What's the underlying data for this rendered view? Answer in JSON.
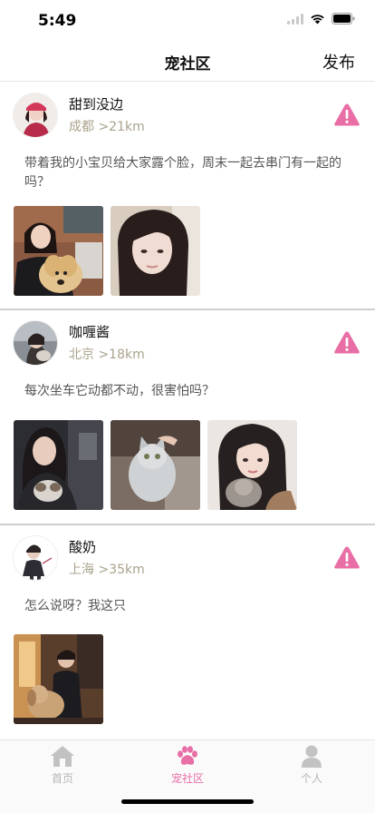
{
  "status_bar": {
    "time": "5:49"
  },
  "nav": {
    "title": "宠社区",
    "publish_label": "发布"
  },
  "posts": [
    {
      "username": "甜到没边",
      "location": "成都 >21km",
      "text": "带着我的小宝贝给大家露个脸，周末一起去串门有一起的吗？",
      "photo_count": 2
    },
    {
      "username": "咖喱酱",
      "location": "北京 >18km",
      "text": "每次坐车它动都不动，很害怕吗？",
      "photo_count": 3
    },
    {
      "username": "酸奶",
      "location": "上海 >35km",
      "text": "怎么说呀？我这只",
      "photo_count": 1
    }
  ],
  "tabs": [
    {
      "label": "首页",
      "icon": "home-icon",
      "active": false
    },
    {
      "label": "宠社区",
      "icon": "paw-icon",
      "active": true
    },
    {
      "label": "个人",
      "icon": "person-icon",
      "active": false
    }
  ],
  "colors": {
    "accent": "#e86ea5",
    "location_text": "#a9a28b",
    "inactive_tab": "#b5b5b5"
  }
}
